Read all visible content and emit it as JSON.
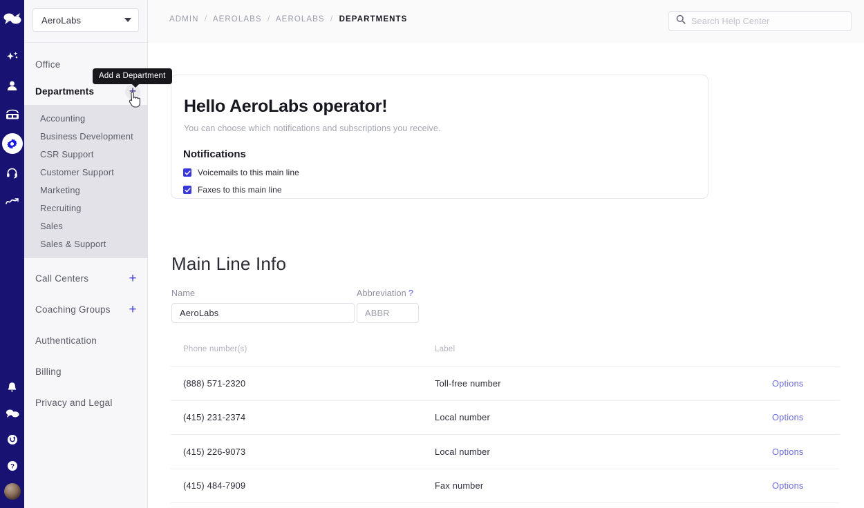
{
  "rail": {
    "icons": [
      {
        "name": "logo-speech-bubbles",
        "active": false
      },
      {
        "name": "sparkle-ai-icon",
        "active": false
      },
      {
        "name": "person-icon",
        "active": false
      },
      {
        "name": "desk-phone-icon",
        "active": false
      },
      {
        "name": "gear-icon",
        "active": true
      },
      {
        "name": "headset-icon",
        "active": false
      },
      {
        "name": "analytics-trend-icon",
        "active": false
      }
    ],
    "bottom_icons": [
      {
        "name": "bell-icon"
      },
      {
        "name": "chat-bubbles-icon"
      },
      {
        "name": "smiley-circle-icon"
      },
      {
        "name": "question-mark-circle-icon"
      },
      {
        "name": "user-avatar"
      }
    ]
  },
  "sidebar": {
    "org_selector": {
      "value": "AeroLabs"
    },
    "nav": [
      {
        "label": "Office",
        "bold": false,
        "has_add": false
      },
      {
        "label": "Departments",
        "bold": true,
        "has_add": true,
        "add_tooltip": "Add a Department"
      },
      {
        "label": "Call Centers",
        "bold": false,
        "has_add": true
      },
      {
        "label": "Coaching Groups",
        "bold": false,
        "has_add": true
      },
      {
        "label": "Authentication",
        "bold": false,
        "has_add": false
      },
      {
        "label": "Billing",
        "bold": false,
        "has_add": false
      },
      {
        "label": "Privacy and Legal",
        "bold": false,
        "has_add": false
      }
    ],
    "departments": [
      "Accounting",
      "Business Development",
      "CSR Support",
      "Customer Support",
      "Marketing",
      "Recruiting",
      "Sales",
      "Sales & Support"
    ]
  },
  "header": {
    "breadcrumb": [
      "ADMIN",
      "AEROLABS",
      "AEROLABS",
      "DEPARTMENTS"
    ],
    "search": {
      "value": "",
      "placeholder": "Search Help Center"
    }
  },
  "card": {
    "title": "Hello AeroLabs operator!",
    "subtitle": "You can choose which notifications and subscriptions you receive.",
    "section_heading": "Notifications",
    "checkboxes": [
      {
        "label": "Voicemails to this main line",
        "checked": true
      },
      {
        "label": "Faxes to this main line",
        "checked": true
      }
    ]
  },
  "main_line": {
    "section_title": "Main Line Info",
    "name_field": {
      "label": "Name",
      "value": "AeroLabs"
    },
    "abbreviation_field": {
      "label": "Abbreviation",
      "hint": "?",
      "value": "ABBR"
    },
    "table": {
      "columns": [
        "Phone number(s)",
        "Label",
        ""
      ],
      "rows": [
        {
          "number": "(888) 571-2320",
          "label": "Toll-free number",
          "action": "Options"
        },
        {
          "number": "(415) 231-2374",
          "label": "Local number",
          "action": "Options"
        },
        {
          "number": "(415) 226-9073",
          "label": "Local number",
          "action": "Options"
        },
        {
          "number": "(415) 484-7909",
          "label": "Fax number",
          "action": "Options"
        }
      ]
    }
  },
  "colors": {
    "rail_bg": "#181273",
    "accent_blue": "#3838dd",
    "link_blue": "#6b6bdc",
    "sidebar_bg": "#f7f7f9",
    "subnav_bg": "#e2e2e8",
    "tooltip_bg": "#18181c"
  }
}
